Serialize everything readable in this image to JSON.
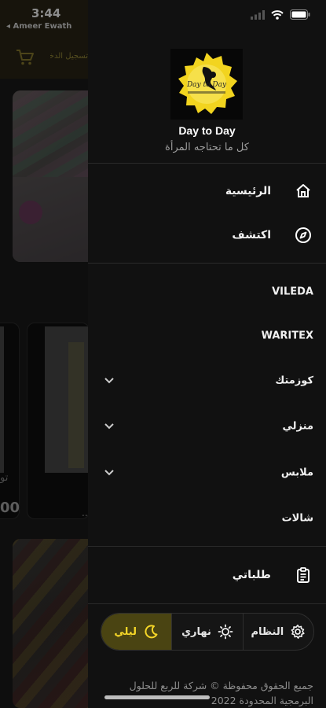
{
  "status_bar": {
    "time": "3:44",
    "back_app": "◂ Ameer Ewath"
  },
  "background": {
    "header_login": "تسجيل الدخول",
    "cart_icon": "cart-icon",
    "partial_product_name": "تو",
    "partial_price": "00",
    "partial_dot": "..."
  },
  "drawer": {
    "logo_text": "Day to Day",
    "shop_name": "Day to Day",
    "shop_tagline": "كل ما تحتاجه المرأة",
    "primary_nav": [
      {
        "label": "الرئيسية",
        "icon": "home-icon"
      },
      {
        "label": "اكتشف",
        "icon": "compass-icon"
      }
    ],
    "categories": [
      {
        "label": "VILEDA",
        "expandable": false
      },
      {
        "label": "WARITEX",
        "expandable": false
      },
      {
        "label": "كوزمتك",
        "expandable": true
      },
      {
        "label": "منزلي",
        "expandable": true
      },
      {
        "label": "ملابس",
        "expandable": true
      },
      {
        "label": "شالات",
        "expandable": false
      }
    ],
    "orders": {
      "label": "طلباتي",
      "icon": "clipboard-icon"
    },
    "theme": {
      "options": [
        {
          "label": "ليلي",
          "icon": "moon-icon",
          "active": true
        },
        {
          "label": "نهاري",
          "icon": "sun-icon",
          "active": false
        },
        {
          "label": "النظام",
          "icon": "gear-icon",
          "active": false
        }
      ],
      "accent": "#f6d728"
    },
    "footer": "جميع الحقوق محفوظة © شركة للربع للحلول البرمجية المحدودة 2022"
  }
}
